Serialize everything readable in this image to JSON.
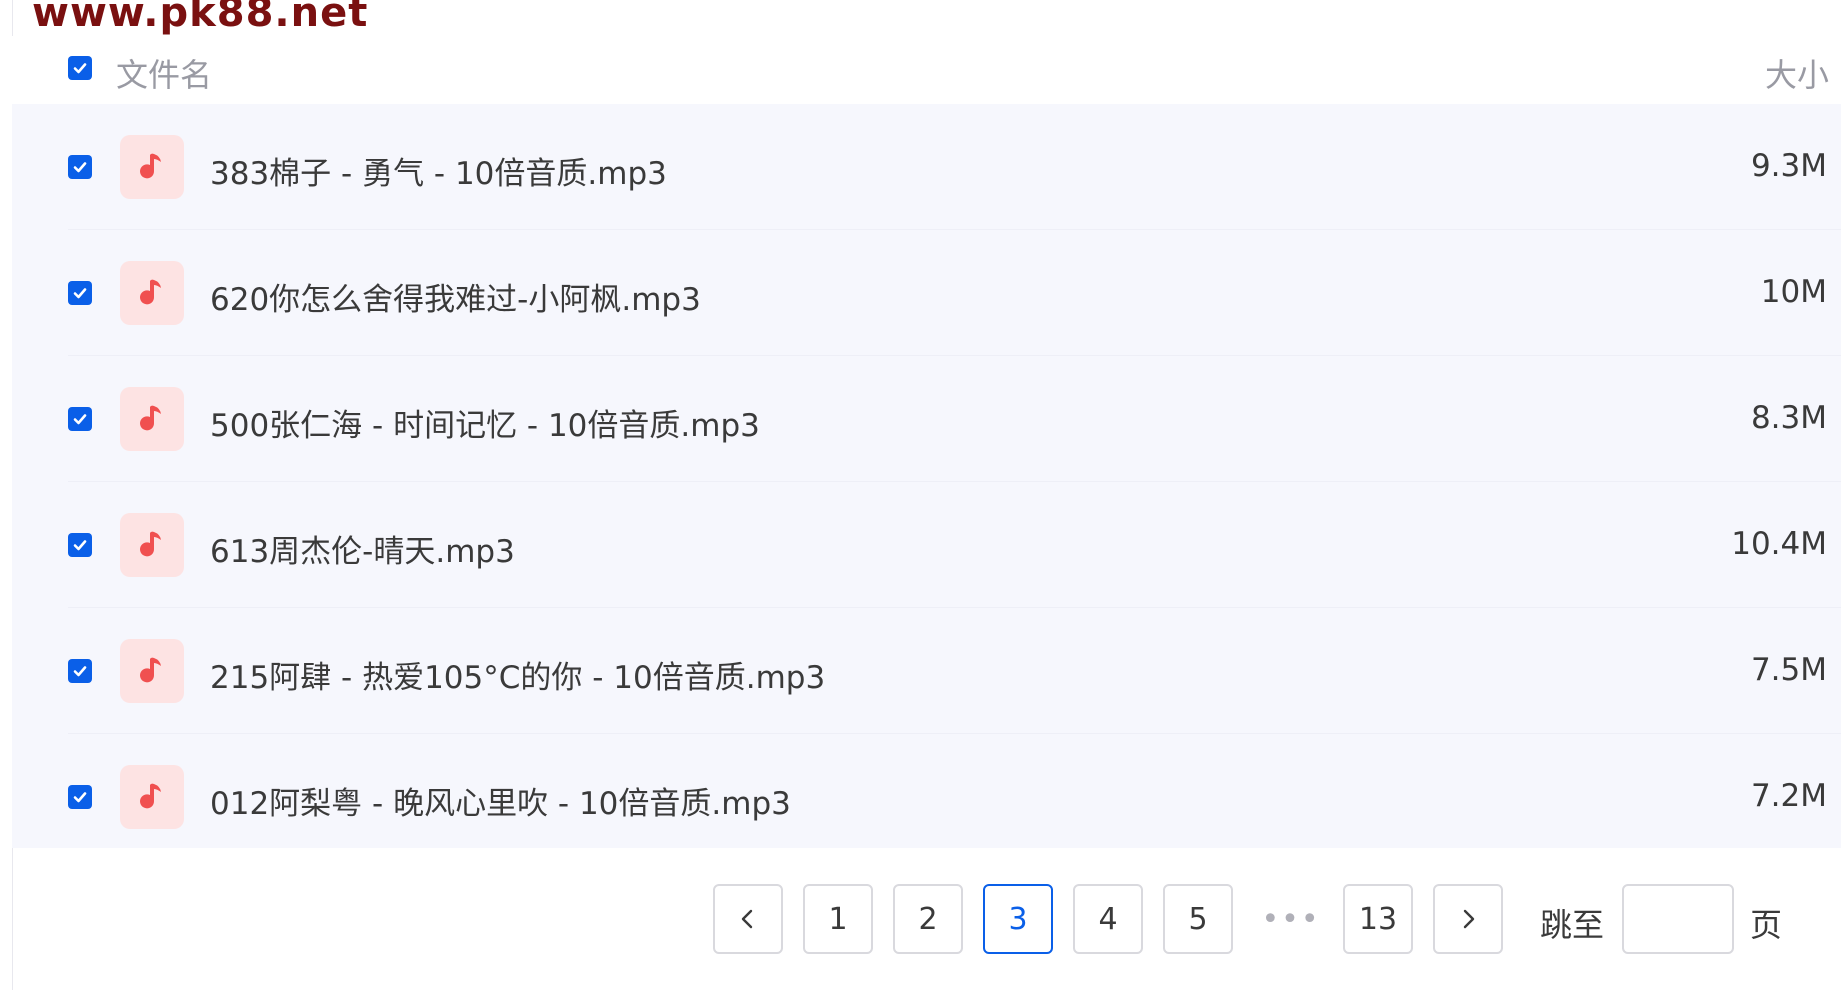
{
  "watermark": "www.pk88.net",
  "header": {
    "name_label": "文件名",
    "size_label": "大小",
    "select_all_checked": true
  },
  "files": [
    {
      "name": "383棉子 - 勇气 - 10倍音质.mp3",
      "size": "9.3M",
      "checked": true,
      "icon": "music-note-icon"
    },
    {
      "name": "620你怎么舍得我难过-小阿枫.mp3",
      "size": "10M",
      "checked": true,
      "icon": "music-note-icon"
    },
    {
      "name": "500张仁海 - 时间记忆 - 10倍音质.mp3",
      "size": "8.3M",
      "checked": true,
      "icon": "music-note-icon"
    },
    {
      "name": "613周杰伦-晴天.mp3",
      "size": "10.4M",
      "checked": true,
      "icon": "music-note-icon"
    },
    {
      "name": "215阿肆 - 热爱105°C的你 - 10倍音质.mp3",
      "size": "7.5M",
      "checked": true,
      "icon": "music-note-icon"
    },
    {
      "name": "012阿梨粤 - 晚风心里吹 - 10倍音质.mp3",
      "size": "7.2M",
      "checked": true,
      "icon": "music-note-icon"
    }
  ],
  "pagination": {
    "pages": [
      "1",
      "2",
      "3",
      "4",
      "5"
    ],
    "current": "3",
    "ellipsis": "•••",
    "last_page": "13",
    "jump_label": "跳至",
    "jump_value": "",
    "page_unit": "页"
  },
  "colors": {
    "accent": "#0a5fe8",
    "icon_bg": "#fde3e3",
    "icon_fg": "#f05050",
    "list_bg": "#f6f7fd"
  }
}
